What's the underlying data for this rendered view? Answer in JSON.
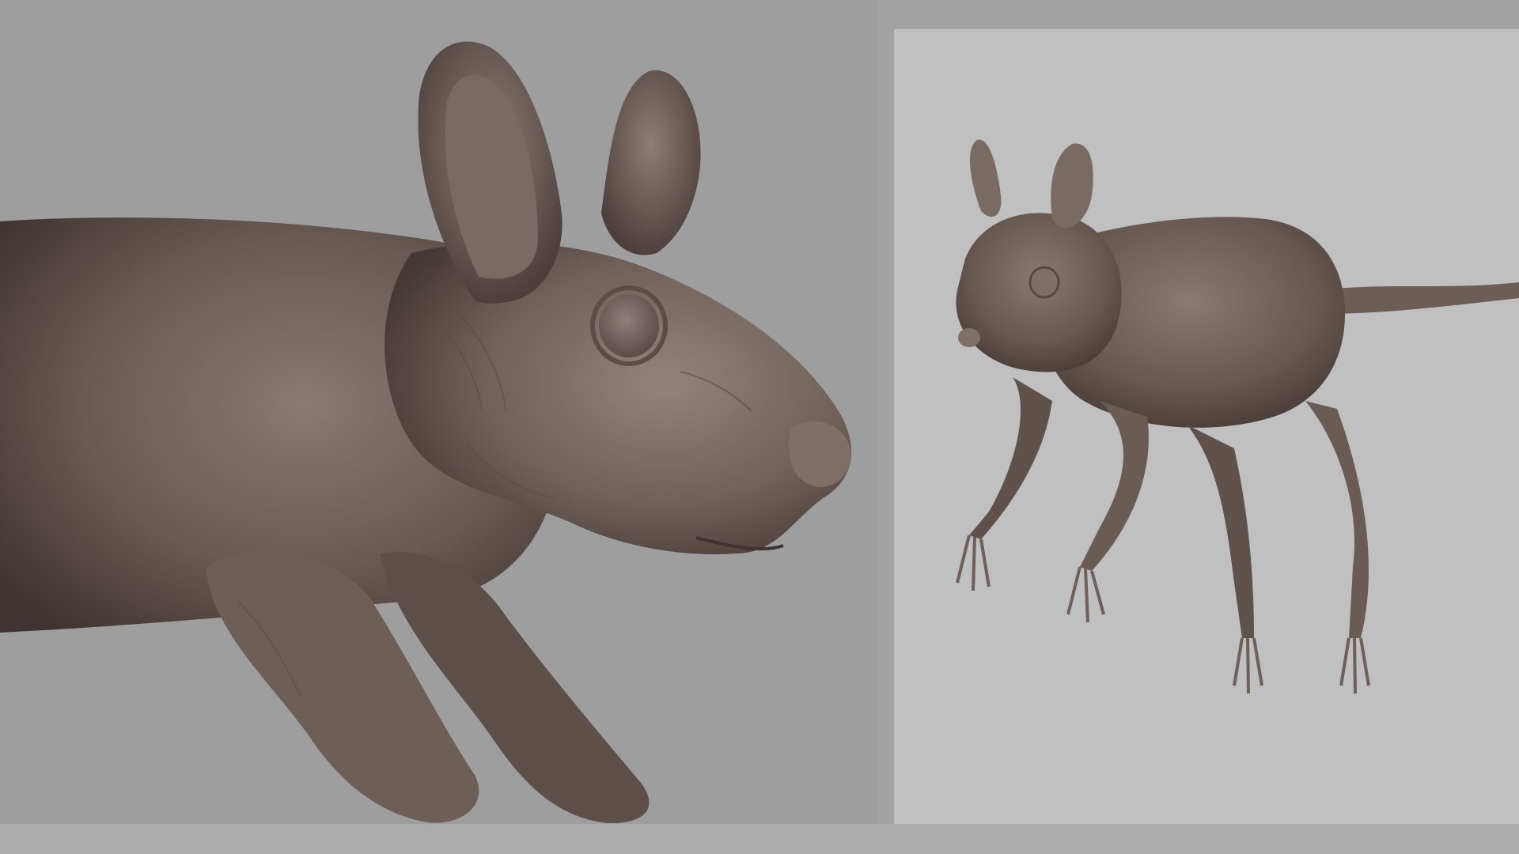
{
  "scene": {
    "description_free": true,
    "views": [
      {
        "id": "closeup-view",
        "subject": "hairless-rodent-sculpt-head-closeup"
      },
      {
        "id": "full-body-view",
        "subject": "hairless-rodent-sculpt-full-body"
      }
    ]
  },
  "colors": {
    "left_background": "#9e9e9e",
    "right_background": "#c0c0c0",
    "frame_background": "#a3a3a3",
    "clay_dark": "#4b3f3b",
    "clay_mid": "#6e5f59",
    "clay_light": "#8d7c75",
    "eye": "#786a65"
  }
}
